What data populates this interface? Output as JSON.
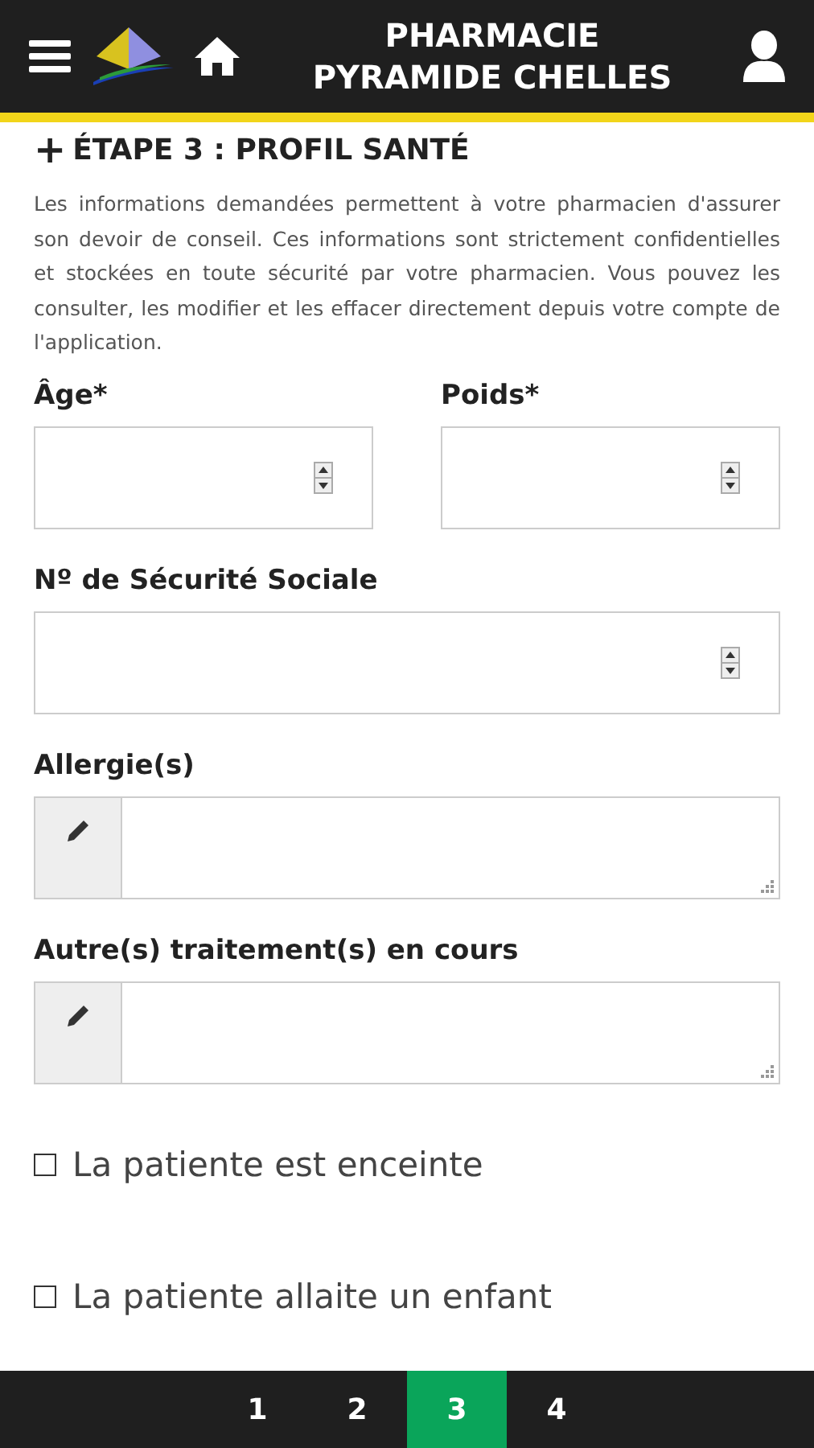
{
  "header": {
    "title_line_1": "PHARMACIE",
    "title_line_2": "PYRAMIDE CHELLES"
  },
  "section": {
    "icon": "+",
    "title": "ÉTAPE 3 : PROFIL SANTÉ"
  },
  "intro": "Les informations demandées permettent à votre pharmacien d'assurer son devoir de conseil. Ces informations sont strictement confidentielles et stockées en toute sécurité par votre pharmacien. Vous pouvez les consulter, les modifier et les effacer directement depuis votre compte de l'application.",
  "field_rows": [
    [
      {
        "label": "Âge*",
        "kind": "number"
      },
      {
        "label": "Poids*",
        "kind": "number"
      }
    ],
    [
      {
        "label": "Nº de Sécurité Sociale",
        "kind": "number"
      }
    ],
    [
      {
        "label": "Allergie(s)",
        "kind": "textarea"
      }
    ],
    [
      {
        "label": "Autre(s) traitement(s) en cours",
        "kind": "textarea"
      }
    ]
  ],
  "checkboxes": [
    {
      "label": "La patiente est enceinte",
      "checked": false
    },
    {
      "label": "La patiente allaite un enfant",
      "checked": false
    }
  ],
  "steps": [
    {
      "label": "1",
      "selected": false
    },
    {
      "label": "2",
      "selected": false
    },
    {
      "label": "3",
      "selected": true
    },
    {
      "label": "4",
      "selected": false
    }
  ]
}
